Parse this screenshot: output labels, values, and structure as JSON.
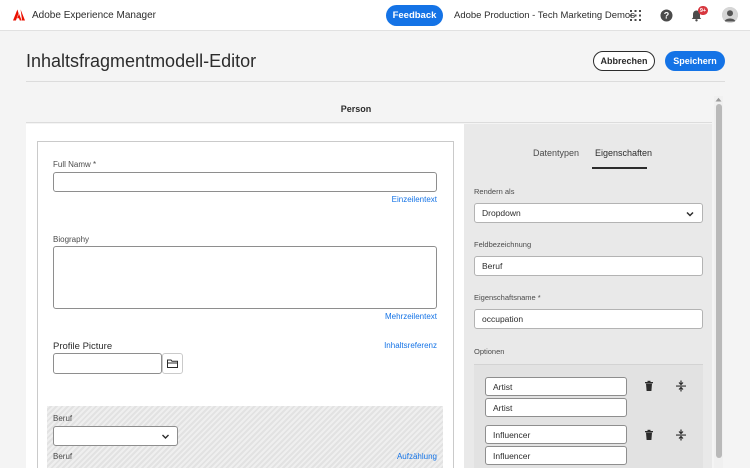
{
  "topbar": {
    "app_title": "Adobe Experience Manager",
    "feedback_label": "Feedback",
    "org_name": "Adobe Production - Tech Marketing Demos",
    "notification_count": "9+"
  },
  "header": {
    "page_title": "Inhaltsfragmentmodell-Editor",
    "cancel_label": "Abbrechen",
    "save_label": "Speichern"
  },
  "model": {
    "name": "Person"
  },
  "canvas": {
    "fields": [
      {
        "label": "Full Namw *",
        "type": "Einzeilentext"
      },
      {
        "label": "Biography",
        "type": "Mehrzeilentext"
      },
      {
        "label": "Profile Picture",
        "type": "Inhaltsreferenz"
      },
      {
        "label": "Beruf",
        "sublabel": "Beruf",
        "type": "Aufzählung"
      }
    ]
  },
  "panel": {
    "tabs": [
      {
        "label": "Datentypen",
        "active": false
      },
      {
        "label": "Eigenschaften",
        "active": true
      }
    ],
    "render_as_label": "Rendern als",
    "render_as_value": "Dropdown",
    "field_label_label": "Feldbezeichnung",
    "field_label_value": "Beruf",
    "property_name_label": "Eigenschaftsname *",
    "property_name_value": "occupation",
    "options_label": "Optionen",
    "options": [
      {
        "label": "Artist",
        "value": "Artist"
      },
      {
        "label": "Influencer",
        "value": "Influencer"
      }
    ]
  },
  "colors": {
    "accent": "#1473e6",
    "brand_red": "#eb1000",
    "badge": "#d7373f"
  },
  "icons": [
    "adobe-logo",
    "apps-grid-icon",
    "help-icon",
    "bell-icon",
    "folder-icon",
    "chevron-down-icon",
    "trash-icon",
    "reorder-icon"
  ]
}
